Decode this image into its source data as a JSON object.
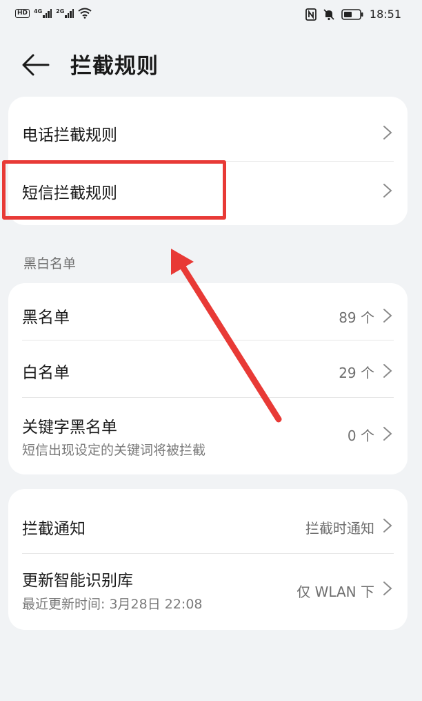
{
  "status_bar": {
    "hd": "HD",
    "net1": "4G",
    "net2": "2G",
    "time": "18:51",
    "icons": [
      "hd-icon",
      "signal-4g-icon",
      "signal-2g-icon",
      "wifi-icon",
      "nfc-icon",
      "mute-bell-icon",
      "battery-icon"
    ]
  },
  "header": {
    "title": "拦截规则",
    "back_icon": "arrow-left-icon"
  },
  "rules_card": {
    "items": [
      {
        "label": "电话拦截规则"
      },
      {
        "label": "短信拦截规则"
      }
    ]
  },
  "list_section": {
    "label": "黑白名单",
    "items": [
      {
        "label": "黑名单",
        "value": "89 个"
      },
      {
        "label": "白名单",
        "value": "29 个"
      },
      {
        "label": "关键字黑名单",
        "sub": "短信出现设定的关键词将被拦截",
        "value": "0 个"
      }
    ]
  },
  "settings_card": {
    "items": [
      {
        "label": "拦截通知",
        "value": "拦截时通知"
      },
      {
        "label": "更新智能识别库",
        "sub": "最近更新时间: 3月28日 22:08",
        "value": "仅 WLAN 下"
      }
    ]
  },
  "annotation": {
    "color": "#e83a36"
  },
  "colors": {
    "background": "#f1f3f5",
    "card": "#ffffff",
    "accent_red": "#e83a36"
  }
}
